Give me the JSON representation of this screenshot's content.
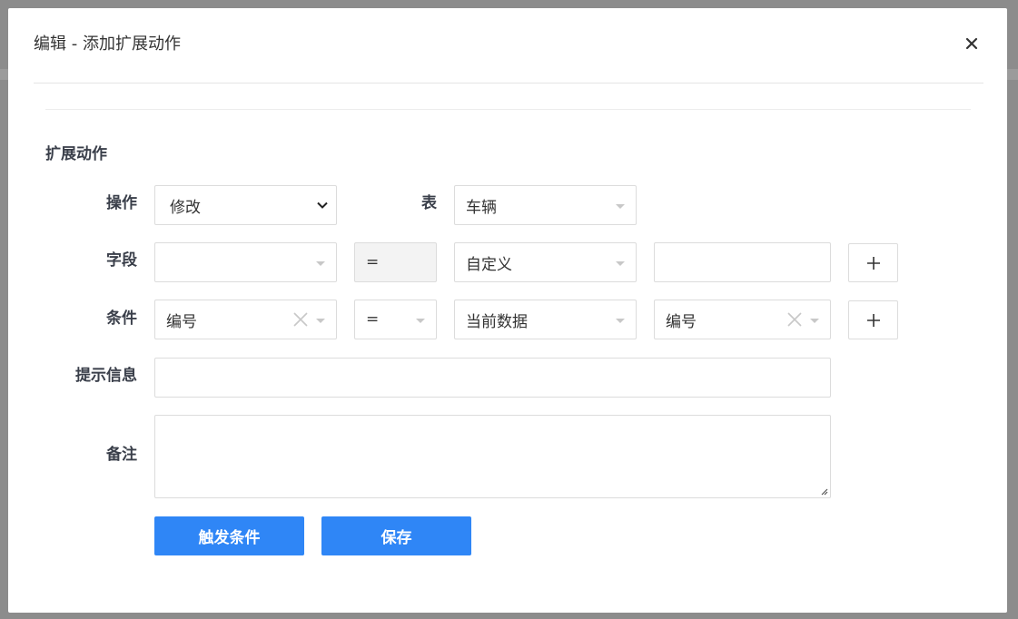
{
  "dialog": {
    "title": "编辑 - 添加扩展动作",
    "section_title": "扩展动作"
  },
  "form": {
    "operation": {
      "label": "操作",
      "value": "修改"
    },
    "table": {
      "label": "表",
      "value": "车辆"
    },
    "field": {
      "label": "字段",
      "field_value": "",
      "operator": "=",
      "source": "自定义",
      "custom_value": ""
    },
    "condition": {
      "label": "条件",
      "field_value": "编号",
      "operator": "=",
      "source": "当前数据",
      "target_value": "编号"
    },
    "prompt": {
      "label": "提示信息",
      "value": ""
    },
    "remark": {
      "label": "备注",
      "value": ""
    }
  },
  "buttons": {
    "trigger_label": "触发条件",
    "save_label": "保存"
  },
  "icons": {
    "close": "close-icon",
    "plus": "plus-icon",
    "clear": "clear-icon",
    "dropdown": "caret-down-icon"
  },
  "colors": {
    "primary": "#2f86f6",
    "overlay": "#8c8c8c",
    "label": "#3a3f4a"
  }
}
